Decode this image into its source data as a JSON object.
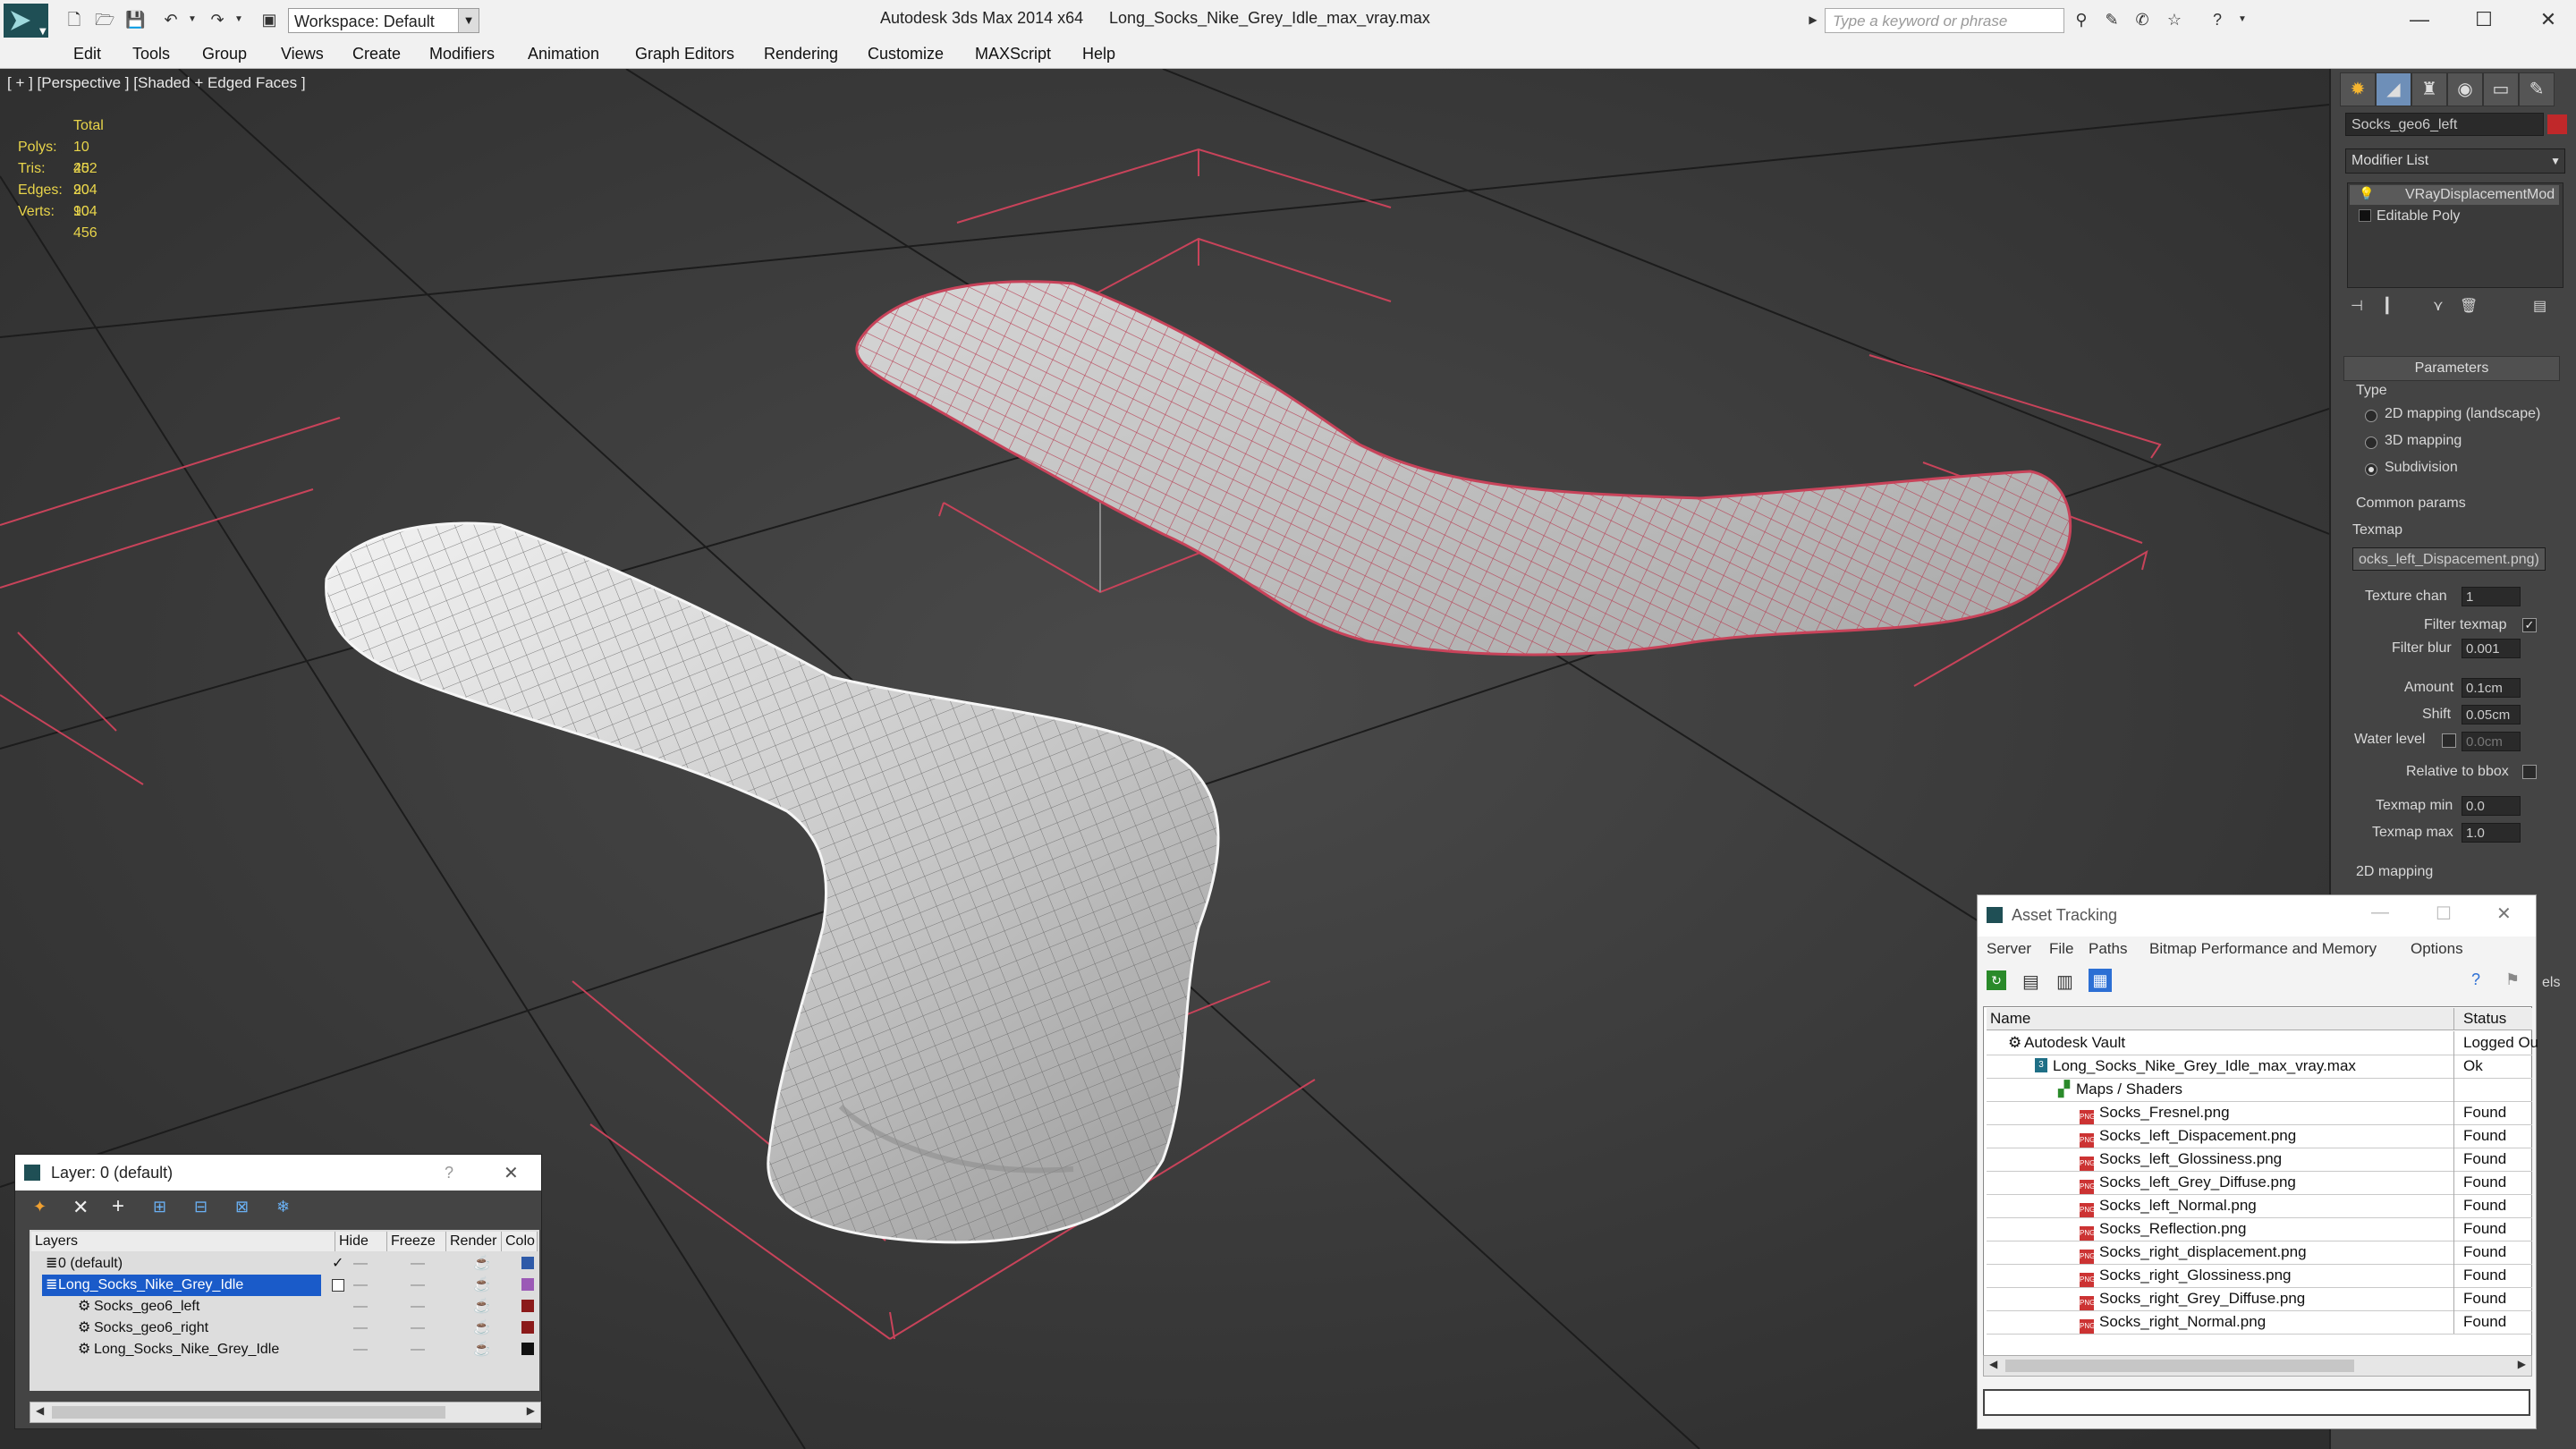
{
  "titlebar": {
    "app_title": "Autodesk 3ds Max  2014 x64",
    "file_title": "Long_Socks_Nike_Grey_Idle_max_vray.max",
    "workspace": "Workspace: Default",
    "search_placeholder": "Type a keyword or phrase"
  },
  "menu": [
    "Edit",
    "Tools",
    "Group",
    "Views",
    "Create",
    "Modifiers",
    "Animation",
    "Graph Editors",
    "Rendering",
    "Customize",
    "MAXScript",
    "Help"
  ],
  "viewport": {
    "label": "[ + ] [Perspective ] [Shaded + Edged Faces ]",
    "stats": {
      "header": "Total",
      "rows": [
        {
          "k": "Polys:",
          "v": "10 452"
        },
        {
          "k": "Tris:",
          "v": "20 904"
        },
        {
          "k": "Edges:",
          "v": "20 904"
        },
        {
          "k": "Verts:",
          "v": "10 456"
        }
      ]
    },
    "colors": {
      "background": "#3c3c3c",
      "grid": "#222222",
      "selection": "#c8435a",
      "mesh_white": "#d9d9d9"
    }
  },
  "command_panel": {
    "object_name": "Socks_geo6_left",
    "object_color": "#c0282a",
    "modifier_list": "Modifier List",
    "stack": [
      "VRayDisplacementMod",
      "Editable Poly"
    ],
    "parameters_title": "Parameters",
    "type_label": "Type",
    "type_options": [
      "2D mapping (landscape)",
      "3D mapping",
      "Subdivision"
    ],
    "type_selected": 2,
    "common_params": "Common params",
    "texmap_label": "Texmap",
    "texmap_value": "ocks_left_Dispacement.png)",
    "texture_chan_label": "Texture chan",
    "texture_chan_value": "1",
    "filter_texmap_label": "Filter texmap",
    "filter_blur_label": "Filter blur",
    "filter_blur_value": "0.001",
    "amount_label": "Amount",
    "amount_value": "0.1cm",
    "shift_label": "Shift",
    "shift_value": "0.05cm",
    "water_level_label": "Water level",
    "water_level_value": "0.0cm",
    "relative_bbox_label": "Relative to bbox",
    "texmap_min_label": "Texmap min",
    "texmap_min_value": "0.0",
    "texmap_max_label": "Texmap max",
    "texmap_max_value": "1.0",
    "mapping_2d_label": "2D mapping",
    "partial_side_text": "els"
  },
  "layer_dialog": {
    "title": "Layer: 0 (default)",
    "help": "?",
    "columns": [
      "Layers",
      "Hide",
      "Freeze",
      "Render",
      "Colo"
    ],
    "rows": [
      {
        "name": "0 (default)",
        "color": "#2e5aa8"
      },
      {
        "name": "Long_Socks_Nike_Grey_Idle",
        "color": "#9b59b6"
      },
      {
        "name": "Socks_geo6_left",
        "color": "#8b1a1a"
      },
      {
        "name": "Socks_geo6_right",
        "color": "#8b1a1a"
      },
      {
        "name": "Long_Socks_Nike_Grey_Idle",
        "color": "#111111"
      }
    ]
  },
  "asset_tracking": {
    "title": "Asset Tracking",
    "menu": [
      "Server",
      "File",
      "Paths",
      "Bitmap Performance and Memory",
      "Options"
    ],
    "col_name": "Name",
    "col_status": "Status",
    "rows": [
      {
        "name": "Autodesk Vault",
        "status": "Logged Ou",
        "kind": "vault"
      },
      {
        "name": "Long_Socks_Nike_Grey_Idle_max_vray.max",
        "status": "Ok",
        "kind": "max"
      },
      {
        "name": "Maps / Shaders",
        "status": "",
        "kind": "folder"
      },
      {
        "name": "Socks_Fresnel.png",
        "status": "Found",
        "kind": "png"
      },
      {
        "name": "Socks_left_Dispacement.png",
        "status": "Found",
        "kind": "png"
      },
      {
        "name": "Socks_left_Glossiness.png",
        "status": "Found",
        "kind": "png"
      },
      {
        "name": "Socks_left_Grey_Diffuse.png",
        "status": "Found",
        "kind": "png"
      },
      {
        "name": "Socks_left_Normal.png",
        "status": "Found",
        "kind": "png"
      },
      {
        "name": "Socks_Reflection.png",
        "status": "Found",
        "kind": "png"
      },
      {
        "name": "Socks_right_displacement.png",
        "status": "Found",
        "kind": "png"
      },
      {
        "name": "Socks_right_Glossiness.png",
        "status": "Found",
        "kind": "png"
      },
      {
        "name": "Socks_right_Grey_Diffuse.png",
        "status": "Found",
        "kind": "png"
      },
      {
        "name": "Socks_right_Normal.png",
        "status": "Found",
        "kind": "png"
      }
    ]
  }
}
